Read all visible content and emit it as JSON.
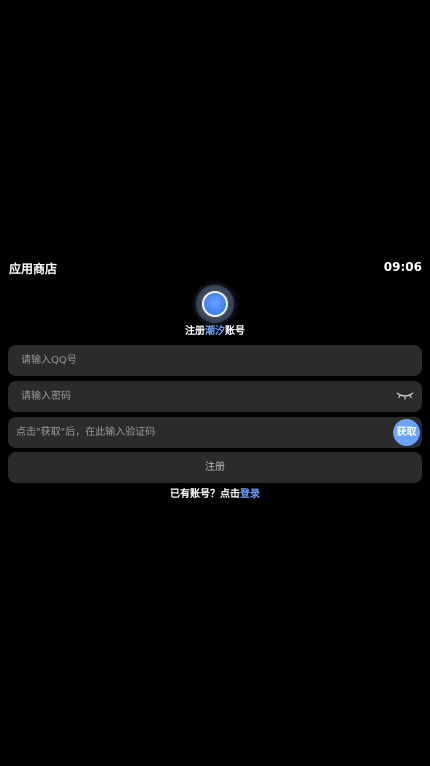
{
  "status_bar": {
    "app_title": "应用商店",
    "time": "09:06"
  },
  "heading": {
    "prefix": "注册",
    "brand": "潮汐",
    "suffix": "账号"
  },
  "form": {
    "qq_placeholder": "请输入QQ号",
    "password_placeholder": "请输入密码",
    "code_placeholder": "点击\"获取\"后，在此输入验证码",
    "get_code_label": "获取",
    "submit_label": "注册"
  },
  "footer": {
    "prompt": "已有账号？点击",
    "login_label": "登录"
  },
  "icons": {
    "logo": "app-logo-icon",
    "password_toggle": "eye-closed-icon"
  },
  "colors": {
    "background": "#000000",
    "field": "#2b2b2b",
    "accent": "#6aa2ff",
    "text": "#ffffff",
    "placeholder": "#9a9a9a"
  }
}
